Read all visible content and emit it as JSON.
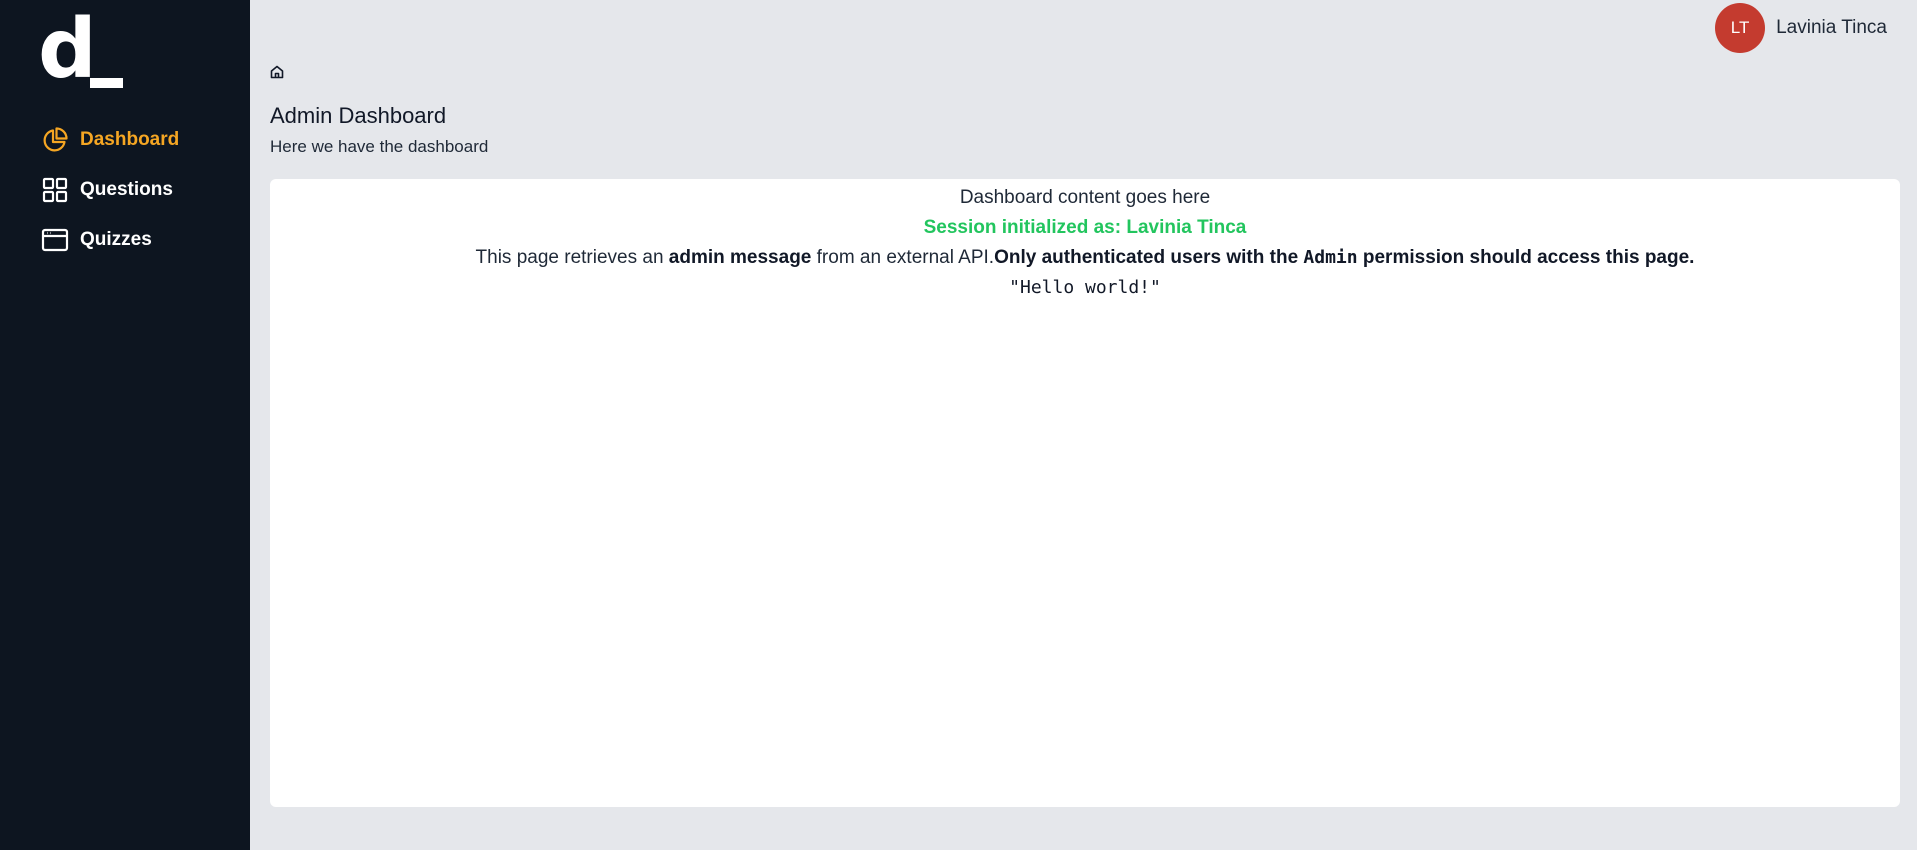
{
  "app": {
    "logo_text": "d_"
  },
  "sidebar": {
    "items": [
      {
        "label": "Dashboard",
        "icon": "pie-chart-icon",
        "active": true
      },
      {
        "label": "Questions",
        "icon": "grid-icon",
        "active": false
      },
      {
        "label": "Quizzes",
        "icon": "browser-window-icon",
        "active": false
      }
    ]
  },
  "user": {
    "initials": "LT",
    "name": "Lavinia Tinca",
    "avatar_color": "#c43b2f"
  },
  "header": {
    "home_icon": "home-icon",
    "title": "Admin Dashboard",
    "subtitle": "Here we have the dashboard"
  },
  "content": {
    "intro": "Dashboard content goes here",
    "session_text": "Session initialized as: Lavinia Tinca",
    "message_part1": "This page retrieves an ",
    "message_bold1": "admin message",
    "message_part2": " from an external API.",
    "message_bold2": "Only authenticated users with the ",
    "message_code": "Admin",
    "message_bold3": " permission should access this page.",
    "api_response": "\"Hello world!\""
  },
  "colors": {
    "sidebar_bg": "#0d1520",
    "accent": "#f5a623",
    "success": "#22c55e",
    "page_bg": "#e5e7eb"
  }
}
